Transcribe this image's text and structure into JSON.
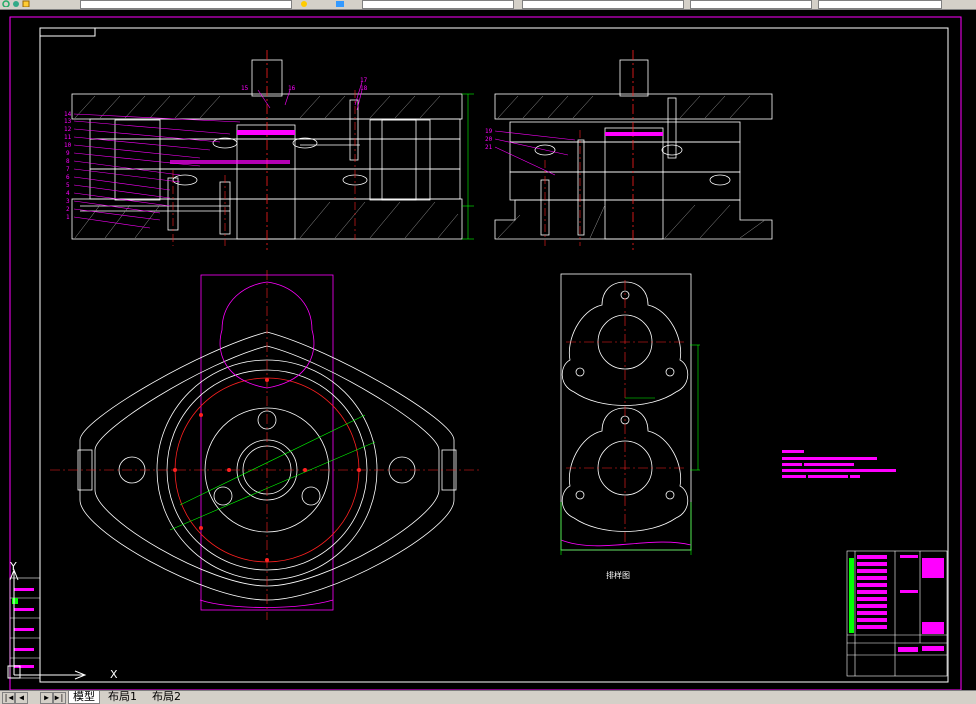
{
  "toolbar": {
    "icons": [
      "refresh-icon",
      "undo-icon",
      "redo-icon",
      "zoom-icon",
      "layer-icon"
    ],
    "fields": [
      "",
      "",
      "",
      "",
      ""
    ]
  },
  "drawing": {
    "section_label": "排样图",
    "callouts_left": [
      "14",
      "13",
      "12",
      "11",
      "10",
      "9",
      "8",
      "7",
      "6",
      "5",
      "4",
      "3",
      "2",
      "1"
    ],
    "callouts_top": [
      "15",
      "16",
      "17",
      "18"
    ],
    "callouts_right": [
      "19",
      "20",
      "21"
    ],
    "axis": {
      "y": "Y",
      "x": "X"
    },
    "colors": {
      "outline": "#ffffff",
      "center": "#ff2020",
      "accent": "#ff00ff",
      "dimension": "#00ff00",
      "frame": "#ff00ff"
    }
  },
  "tabs": {
    "model": "模型",
    "layout1": "布局1",
    "layout2": "布局2"
  }
}
